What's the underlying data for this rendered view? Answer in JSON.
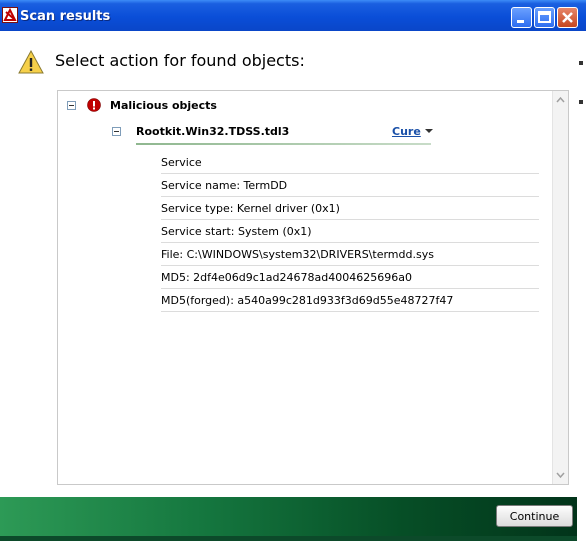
{
  "window": {
    "title": "Scan results"
  },
  "header": {
    "prompt": "Select action for found objects:",
    "icon": "warning-icon"
  },
  "tree": {
    "group": {
      "label": "Malicious objects",
      "icon": "error-icon"
    },
    "threat": {
      "name": "Rootkit.Win32.TDSS.tdl3",
      "action": "Cure"
    },
    "details": [
      "Service",
      "Service name: TermDD",
      "Service type: Kernel driver (0x1)",
      "Service start: System (0x1)",
      "File: C:\\WINDOWS\\system32\\DRIVERS\\termdd.sys",
      "MD5: 2df4e06d9c1ad24678ad4004625696a0",
      "MD5(forged): a540a99c281d933f3d69d55e48727f47"
    ]
  },
  "footer": {
    "continue_label": "Continue"
  },
  "colors": {
    "titlebar": "#0a4ed8",
    "link": "#1a50a8",
    "footer_green": "#15773f"
  }
}
